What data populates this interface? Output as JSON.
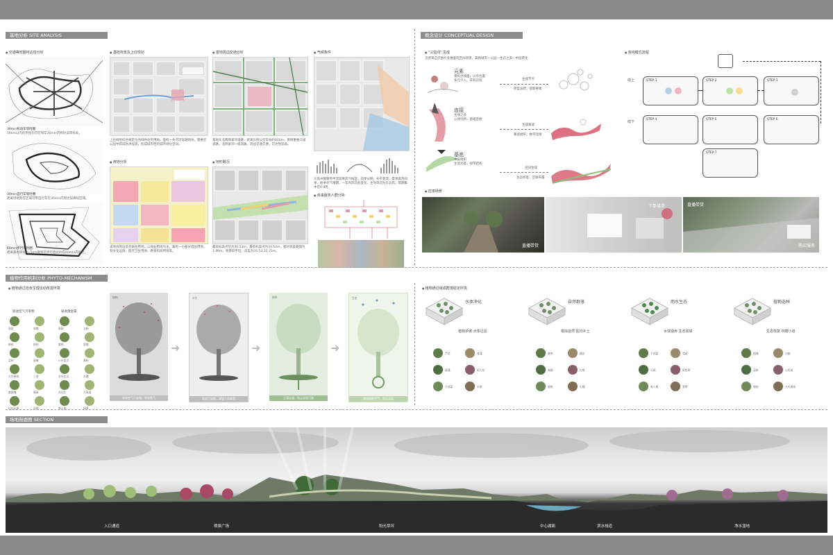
{
  "sections": {
    "site_analysis": "基地分析  SITE ANALYSIS",
    "conceptual_design": "概念设计  CONCEPTUAL DESIGN",
    "phyto_mechanism": "植物作用机制分析  PHYTO-MECHANISM",
    "section": "场地剖面图  SECTION"
  },
  "site": {
    "isochrone_title": "交通等时圈可达性分析",
    "iso1_cap": "30min机动车等时圈",
    "iso1_text": "16km以内的步程均可在驾车30min内到达该目标处。",
    "iso2_cap": "30min自行车等时圈",
    "iso2_text": "距离场地所在区域可用自行车在30min内到达该目标区域。",
    "iso3_cap": "60min步行等时圈",
    "iso3_text": "距离基地目标3~5km即到可步行直达约在60min内到达。",
    "background_title": "基地背景及上位规划",
    "background_text": "上位规划综合规定位为绿色住宅用地，面有一条河流穿越场地，需要在公园中布局防洪设施，形成城市性的城市绿化空间。",
    "traffic_title": "基地周边交通分析",
    "traffic_text": "基地东北两侧紧邻道路，距离东侧公交车站约800m，南侧重要三级道路。北侧紧邻一级道路。周边交通方便，可达性较高。",
    "climate_title": "气候条件",
    "climate_text": "大荔州属暖带半湿润季风气候区，四季分明；冬干夏湿，夏季雨热同季，秋季天气晴朗，一年内风向有变化，主导风向为东北风，雨期集中在6-8月。",
    "landuse_title": "用地分析",
    "landuse_text": "该地块周边多为居住用地，以商业用地为主，兼有一小部分混合用地。有文化设施、医疗卫生用地、教育科研用地等。",
    "terrain_title": "地形概况",
    "terrain_text": "最高标高点位为36.53m，最低标高点为34.64m，相对高差最值为1.89m。地勢较平坦，高差为35.53-35.73m。",
    "crowd_title": "未来服务人群分析"
  },
  "concept": {
    "three_space_title": "\"三空间\" 生成",
    "three_space_text": "灵感来自于图片多维度的空间场景，兼顾城市—公园—生态之多—中层转化",
    "elem1": "元素",
    "elem1_sub": "重构点线面，以点位置\n多元介入，常有识别",
    "elem1_arrow": "生成节点",
    "elem1_note": "原型总结，提取要素",
    "elem2": "连接",
    "elem2_sub": "生线之多\n公共场所，管理连接",
    "elem2_arrow": "生成廊道",
    "elem2_note": "路径组织，数字连接",
    "elem3": "基底",
    "elem3_sub": "中层组织\n生境为基，绿带结构",
    "elem3_arrow": "空间生成",
    "elem3_note": "生态修复，互联布置",
    "dual_title": "双线模式流程",
    "line1": "线上",
    "line2": "线下",
    "steps": [
      "STEP 1",
      "STEP 2",
      "STEP 3",
      "STEP 4",
      "STEP 5",
      "STEP 6",
      "STEP 7"
    ],
    "dual_labels": [
      "直播带货",
      "下单接单",
      "直播带货",
      "购买服务"
    ],
    "live_title": "应用场景"
  },
  "phyto": {
    "left_title": "植物通过自身生理活动改善环境",
    "col1": "吸收空气污染物",
    "col2": "吸收重金属",
    "left_plants": [
      "银杏",
      "刺槐",
      "垂柳",
      "法桐",
      "柳树",
      "桧柏",
      "紫荆",
      "国槐",
      "栾树",
      "臭椿",
      "小叶女贞",
      "黄杨",
      "大叶黄杨",
      "丁香",
      "金叶女贞",
      "木槿",
      "紫穗槐",
      "蜀葵",
      "凤仙花",
      "万寿菊",
      "红叶石楠",
      "连翘",
      "美人蕉",
      "绿萝"
    ],
    "tree_captions": [
      "吸收空气污染物，释放氧气",
      "吸收污染物，减轻人体毒害",
      "土壤过滤，防止水质污染",
      "释放新鲜空气，净化水体"
    ],
    "tree_labels": [
      "植物",
      "叶片",
      "根系",
      "生态"
    ],
    "right_title": "植物通过组成群落稳定环境",
    "iso": [
      {
        "title": "水体净化",
        "sub": "植物护坡  水体过滤"
      },
      {
        "title": "自然群落",
        "sub": "模拟自然  回归乡土"
      },
      {
        "title": "雨水生态",
        "sub": "水体涵养  生态驳岸"
      },
      {
        "title": "植物选林",
        "sub": "生态恢复  林荫小道"
      }
    ],
    "right_plants": [
      "芦苇",
      "香蒲",
      "菖蒲",
      "再力花",
      "千屈菜",
      "水葱",
      "紫荆",
      "樱花",
      "海棠",
      "红枫",
      "碧桃",
      "石榴",
      "千屈菜",
      "鸢尾",
      "马蔺",
      "醉鱼草",
      "美人蕉",
      "萱草",
      "国槐",
      "白蜡",
      "栾树",
      "火炬树",
      "侧柏",
      "大叶黄杨"
    ]
  },
  "section": {
    "labels": [
      "入口通道",
      "喷泉广场",
      "阳光草坪",
      "中心湖面",
      "滨水栈道",
      "净水湿地"
    ]
  },
  "colors": {
    "header_bg": "#8c8c8c",
    "accent_pink": "#d44d62",
    "accent_green": "#7dbb6e"
  }
}
